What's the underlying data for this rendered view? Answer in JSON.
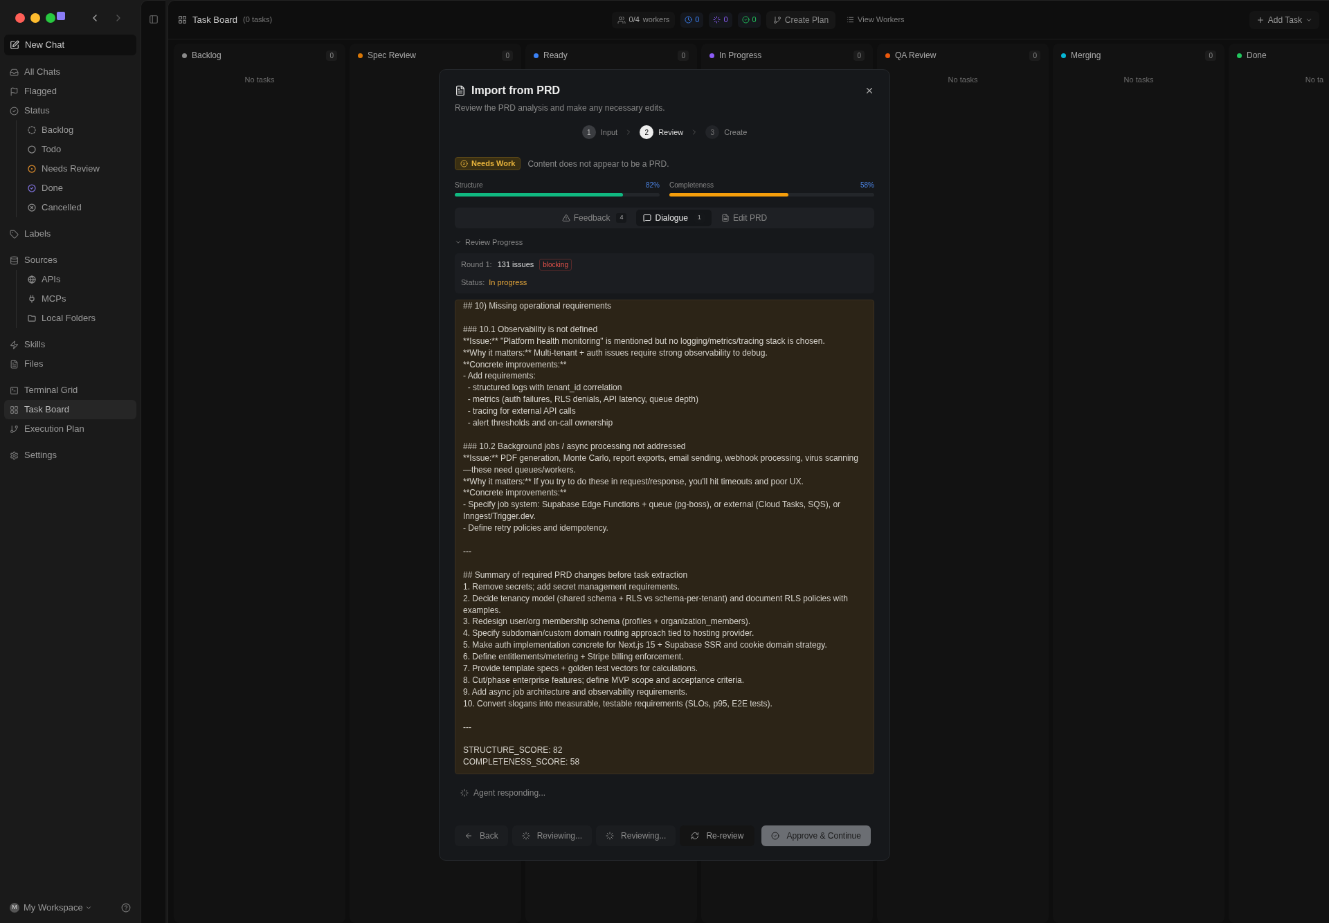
{
  "sidebar": {
    "new_chat": "New Chat",
    "sections": [
      [
        {
          "label": "All Chats",
          "selected": false
        },
        {
          "label": "Flagged",
          "selected": false
        },
        {
          "label": "Status",
          "selected": false,
          "children": [
            {
              "label": "Backlog",
              "kind": "backlog"
            },
            {
              "label": "Todo",
              "kind": "todo"
            },
            {
              "label": "Needs Review",
              "kind": "review"
            },
            {
              "label": "Done",
              "kind": "done"
            },
            {
              "label": "Cancelled",
              "kind": "cancelled"
            }
          ]
        }
      ],
      [
        {
          "label": "Labels",
          "selected": false
        }
      ],
      [
        {
          "label": "Sources",
          "selected": false,
          "children": [
            {
              "label": "APIs",
              "kind": "globe"
            },
            {
              "label": "MCPs",
              "kind": "plug"
            },
            {
              "label": "Local Folders",
              "kind": "folder"
            }
          ]
        }
      ],
      [
        {
          "label": "Skills",
          "selected": false
        },
        {
          "label": "Files",
          "selected": false
        }
      ],
      [
        {
          "label": "Terminal Grid",
          "selected": false
        },
        {
          "label": "Task Board",
          "selected": true
        },
        {
          "label": "Execution Plan",
          "selected": false
        }
      ],
      [
        {
          "label": "Settings",
          "selected": false
        }
      ]
    ],
    "workspace": {
      "initial": "M",
      "name": "My Workspace"
    }
  },
  "topbar": {
    "title": "Task Board",
    "count": "(0 tasks)",
    "workers": "0/4",
    "workers_label": "workers",
    "counters": [
      {
        "value": "0",
        "kind": "queued"
      },
      {
        "value": "0",
        "kind": "running"
      },
      {
        "value": "0",
        "kind": "done"
      }
    ],
    "create_plan": "Create Plan",
    "view_workers": "View Workers",
    "add_task": "Add Task"
  },
  "columns": [
    {
      "name": "Backlog",
      "color": "#8a8a8a",
      "count": "0",
      "empty_text": "No tasks"
    },
    {
      "name": "Spec Review",
      "color": "#d97706",
      "count": "0"
    },
    {
      "name": "Ready",
      "color": "#3b82f6",
      "count": "0"
    },
    {
      "name": "In Progress",
      "color": "#8b5cf6",
      "count": "0"
    },
    {
      "name": "QA Review",
      "color": "#ea580c",
      "count": "0",
      "empty_text": "No tasks"
    },
    {
      "name": "Merging",
      "color": "#06b6d4",
      "count": "0",
      "empty_text": "No tasks"
    },
    {
      "name": "Done",
      "color": "#22c55e",
      "empty_text": "No ta"
    }
  ],
  "dialog": {
    "title": "Import from PRD",
    "subtitle": "Review the PRD analysis and make any necessary edits.",
    "steps": [
      {
        "number": "1",
        "label": "Input",
        "selected": false,
        "completed": true
      },
      {
        "number": "2",
        "label": "Review",
        "selected": true,
        "completed": false
      },
      {
        "number": "3",
        "label": "Create",
        "selected": false,
        "completed": false
      }
    ],
    "verdict": {
      "badge": "Needs Work",
      "message": "Content does not appear to be a PRD."
    },
    "scores": [
      {
        "label": "Structure",
        "reading": "82%",
        "level": 0.82,
        "color": "#10b981"
      },
      {
        "label": "Completeness",
        "reading": "58%",
        "level": 0.58,
        "color": "#f59e0b"
      }
    ],
    "tabs": [
      {
        "label": "Feedback",
        "count": "4",
        "selected": false
      },
      {
        "label": "Dialogue",
        "count": "1",
        "selected": true
      },
      {
        "label": "Edit PRD",
        "selected": false
      }
    ],
    "review_progress": {
      "title": "Review Progress",
      "expanded": true,
      "round_label": "Round 1:",
      "issues": "131 issues",
      "tag": "blocking",
      "status_label": "Status:",
      "status": "In progress"
    },
    "content_blocks": [
      [
        "## 10) Missing operational requirements"
      ],
      [
        "### 10.1 Observability is not defined",
        "**Issue:** \"Platform health monitoring\" is mentioned but no logging/metrics/tracing stack is chosen.",
        "**Why it matters:** Multi-tenant + auth issues require strong observability to debug.",
        "**Concrete improvements:**",
        "- Add requirements:",
        "  - structured logs with tenant_id correlation",
        "  - metrics (auth failures, RLS denials, API latency, queue depth)",
        "  - tracing for external API calls",
        "  - alert thresholds and on-call ownership"
      ],
      [
        "### 10.2 Background jobs / async processing not addressed",
        "**Issue:** PDF generation, Monte Carlo, report exports, email sending, webhook processing, virus scanning—these need queues/workers.",
        "**Why it matters:** If you try to do these in request/response, you'll hit timeouts and poor UX.",
        "**Concrete improvements:**",
        "- Specify job system: Supabase Edge Functions + queue (pg-boss), or external (Cloud Tasks, SQS), or Inngest/Trigger.dev.",
        "- Define retry policies and idempotency."
      ],
      [
        "---"
      ],
      [
        "## Summary of required PRD changes before task extraction",
        "1. Remove secrets; add secret management requirements.",
        "2. Decide tenancy model (shared schema + RLS vs schema-per-tenant) and document RLS policies with examples.",
        "3. Redesign user/org membership schema (profiles + organization_members).",
        "4. Specify subdomain/custom domain routing approach tied to hosting provider.",
        "5. Make auth implementation concrete for Next.js 15 + Supabase SSR and cookie domain strategy.",
        "6. Define entitlements/metering + Stripe billing enforcement.",
        "7. Provide template specs + golden test vectors for calculations.",
        "8. Cut/phase enterprise features; define MVP scope and acceptance criteria.",
        "9. Add async job architecture and observability requirements.",
        "10. Convert slogans into measurable, testable requirements (SLOs, p95, E2E tests)."
      ],
      [
        "---"
      ],
      [
        "STRUCTURE_SCORE: 82",
        "COMPLETENESS_SCORE: 58"
      ]
    ],
    "agent_status": "Agent responding...",
    "buttons": [
      {
        "label": "Back",
        "kind": "back"
      },
      {
        "label": "Reviewing...",
        "kind": "busy"
      },
      {
        "label": "Reviewing...",
        "kind": "busy"
      },
      {
        "label": "Re-review",
        "kind": "rerun"
      },
      {
        "label": "Approve & Continue",
        "kind": "primary"
      }
    ]
  }
}
